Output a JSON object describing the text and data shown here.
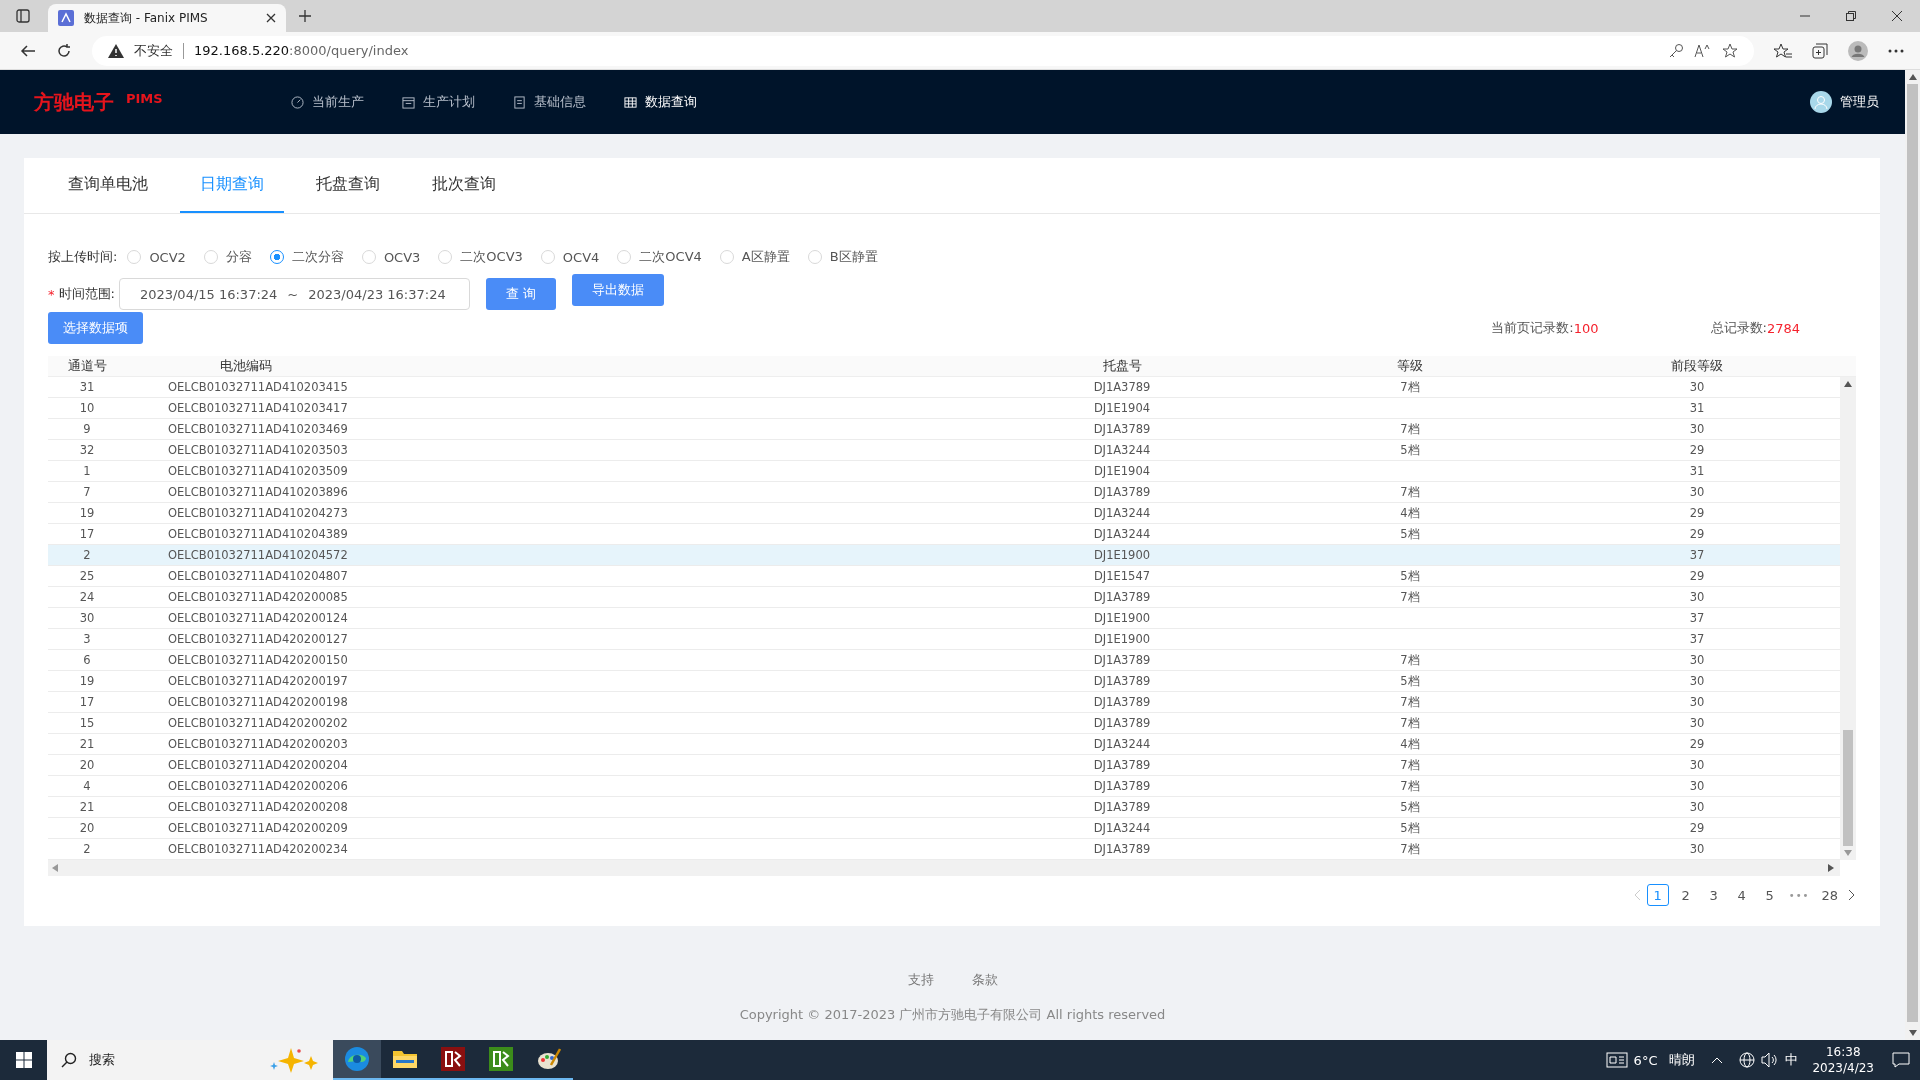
{
  "browser": {
    "tab_title": "数据查询 - Fanix PIMS",
    "security_label": "不安全",
    "url_host": "192.168.5.220",
    "url_rest": ":8000/query/index"
  },
  "nav": {
    "logo": "方驰电子",
    "logo_suffix": "PIMS",
    "items": [
      {
        "label": "当前生产",
        "kind": "gauge",
        "selected": false
      },
      {
        "label": "生产计划",
        "kind": "calendar",
        "selected": false
      },
      {
        "label": "基础信息",
        "kind": "doc",
        "selected": false
      },
      {
        "label": "数据查询",
        "kind": "grid",
        "selected": true
      }
    ],
    "user": "管理员"
  },
  "tabs": [
    {
      "label": "查询单电池",
      "selected": false
    },
    {
      "label": "日期查询",
      "selected": true
    },
    {
      "label": "托盘查询",
      "selected": false
    },
    {
      "label": "批次查询",
      "selected": false
    }
  ],
  "filter": {
    "label": "按上传时间:",
    "options": [
      {
        "label": "OCV2",
        "selected": false
      },
      {
        "label": "分容",
        "selected": false
      },
      {
        "label": "二次分容",
        "selected": true
      },
      {
        "label": "OCV3",
        "selected": false
      },
      {
        "label": "二次OCV3",
        "selected": false
      },
      {
        "label": "OCV4",
        "selected": false
      },
      {
        "label": "二次OCV4",
        "selected": false
      },
      {
        "label": "A区静置",
        "selected": false
      },
      {
        "label": "B区静置",
        "selected": false
      }
    ],
    "required_mark": "*",
    "range_label": "时间范围:",
    "start": "2023/04/15 16:37:24",
    "separator": "~",
    "end": "2023/04/23 16:37:24",
    "query_button": "查 询",
    "export_button": "导出数据",
    "select_button": "选择数据项"
  },
  "stats": {
    "current_label": "当前页记录数:",
    "current_value": "100",
    "total_label": "总记录数:",
    "total_value": "2784"
  },
  "table": {
    "columns": [
      "通道号",
      "电池编码",
      "托盘号",
      "等级",
      "前段等级"
    ],
    "rows": [
      {
        "channel": "31",
        "code": "OELCB01032711AD410203415",
        "tray": "DJ1A3789",
        "grade": "7档",
        "prev_grade": "30",
        "selected": false
      },
      {
        "channel": "10",
        "code": "OELCB01032711AD410203417",
        "tray": "DJ1E1904",
        "prev_grade": "31",
        "selected": false
      },
      {
        "channel": "9",
        "code": "OELCB01032711AD410203469",
        "tray": "DJ1A3789",
        "grade": "7档",
        "prev_grade": "30",
        "selected": false
      },
      {
        "channel": "32",
        "code": "OELCB01032711AD410203503",
        "tray": "DJ1A3244",
        "grade": "5档",
        "prev_grade": "29",
        "selected": false
      },
      {
        "channel": "1",
        "code": "OELCB01032711AD410203509",
        "tray": "DJ1E1904",
        "prev_grade": "31",
        "selected": false
      },
      {
        "channel": "7",
        "code": "OELCB01032711AD410203896",
        "tray": "DJ1A3789",
        "grade": "7档",
        "prev_grade": "30",
        "selected": false
      },
      {
        "channel": "19",
        "code": "OELCB01032711AD410204273",
        "tray": "DJ1A3244",
        "grade": "4档",
        "prev_grade": "29",
        "selected": false
      },
      {
        "channel": "17",
        "code": "OELCB01032711AD410204389",
        "tray": "DJ1A3244",
        "grade": "5档",
        "prev_grade": "29",
        "selected": false
      },
      {
        "channel": "2",
        "code": "OELCB01032711AD410204572",
        "tray": "DJ1E1900",
        "prev_grade": "37",
        "selected": true
      },
      {
        "channel": "25",
        "code": "OELCB01032711AD410204807",
        "tray": "DJ1E1547",
        "grade": "5档",
        "prev_grade": "29",
        "selected": false
      },
      {
        "channel": "24",
        "code": "OELCB01032711AD420200085",
        "tray": "DJ1A3789",
        "grade": "7档",
        "prev_grade": "30",
        "selected": false
      },
      {
        "channel": "30",
        "code": "OELCB01032711AD420200124",
        "tray": "DJ1E1900",
        "prev_grade": "37",
        "selected": false
      },
      {
        "channel": "3",
        "code": "OELCB01032711AD420200127",
        "tray": "DJ1E1900",
        "prev_grade": "37",
        "selected": false
      },
      {
        "channel": "6",
        "code": "OELCB01032711AD420200150",
        "tray": "DJ1A3789",
        "grade": "7档",
        "prev_grade": "30",
        "selected": false
      },
      {
        "channel": "19",
        "code": "OELCB01032711AD420200197",
        "tray": "DJ1A3789",
        "grade": "5档",
        "prev_grade": "30",
        "selected": false
      },
      {
        "channel": "17",
        "code": "OELCB01032711AD420200198",
        "tray": "DJ1A3789",
        "grade": "7档",
        "prev_grade": "30",
        "selected": false
      },
      {
        "channel": "15",
        "code": "OELCB01032711AD420200202",
        "tray": "DJ1A3789",
        "grade": "7档",
        "prev_grade": "30",
        "selected": false
      },
      {
        "channel": "21",
        "code": "OELCB01032711AD420200203",
        "tray": "DJ1A3244",
        "grade": "4档",
        "prev_grade": "29",
        "selected": false
      },
      {
        "channel": "20",
        "code": "OELCB01032711AD420200204",
        "tray": "DJ1A3789",
        "grade": "7档",
        "prev_grade": "30",
        "selected": false
      },
      {
        "channel": "4",
        "code": "OELCB01032711AD420200206",
        "tray": "DJ1A3789",
        "grade": "7档",
        "prev_grade": "30",
        "selected": false
      },
      {
        "channel": "21",
        "code": "OELCB01032711AD420200208",
        "tray": "DJ1A3789",
        "grade": "5档",
        "prev_grade": "30",
        "selected": false
      },
      {
        "channel": "20",
        "code": "OELCB01032711AD420200209",
        "tray": "DJ1A3244",
        "grade": "5档",
        "prev_grade": "29",
        "selected": false
      },
      {
        "channel": "2",
        "code": "OELCB01032711AD420200234",
        "tray": "DJ1A3789",
        "grade": "7档",
        "prev_grade": "30",
        "selected": false
      }
    ]
  },
  "pagination": {
    "pages": [
      {
        "label": "1",
        "selected": true
      },
      {
        "label": "2",
        "selected": false
      },
      {
        "label": "3",
        "selected": false
      },
      {
        "label": "4",
        "selected": false
      },
      {
        "label": "5",
        "selected": false
      }
    ],
    "ellipsis": "•••",
    "last": {
      "label": "28",
      "selected": false
    }
  },
  "footer": {
    "links": [
      "支持",
      "条款"
    ],
    "copyright": "Copyright © 2017-2023 广州市方驰电子有限公司 All rights reserved"
  },
  "taskbar": {
    "search_placeholder": "搜索",
    "weather": "6°C",
    "weather_text": "晴朗",
    "ime": "中",
    "time": "16:38",
    "date": "2023/4/23"
  }
}
